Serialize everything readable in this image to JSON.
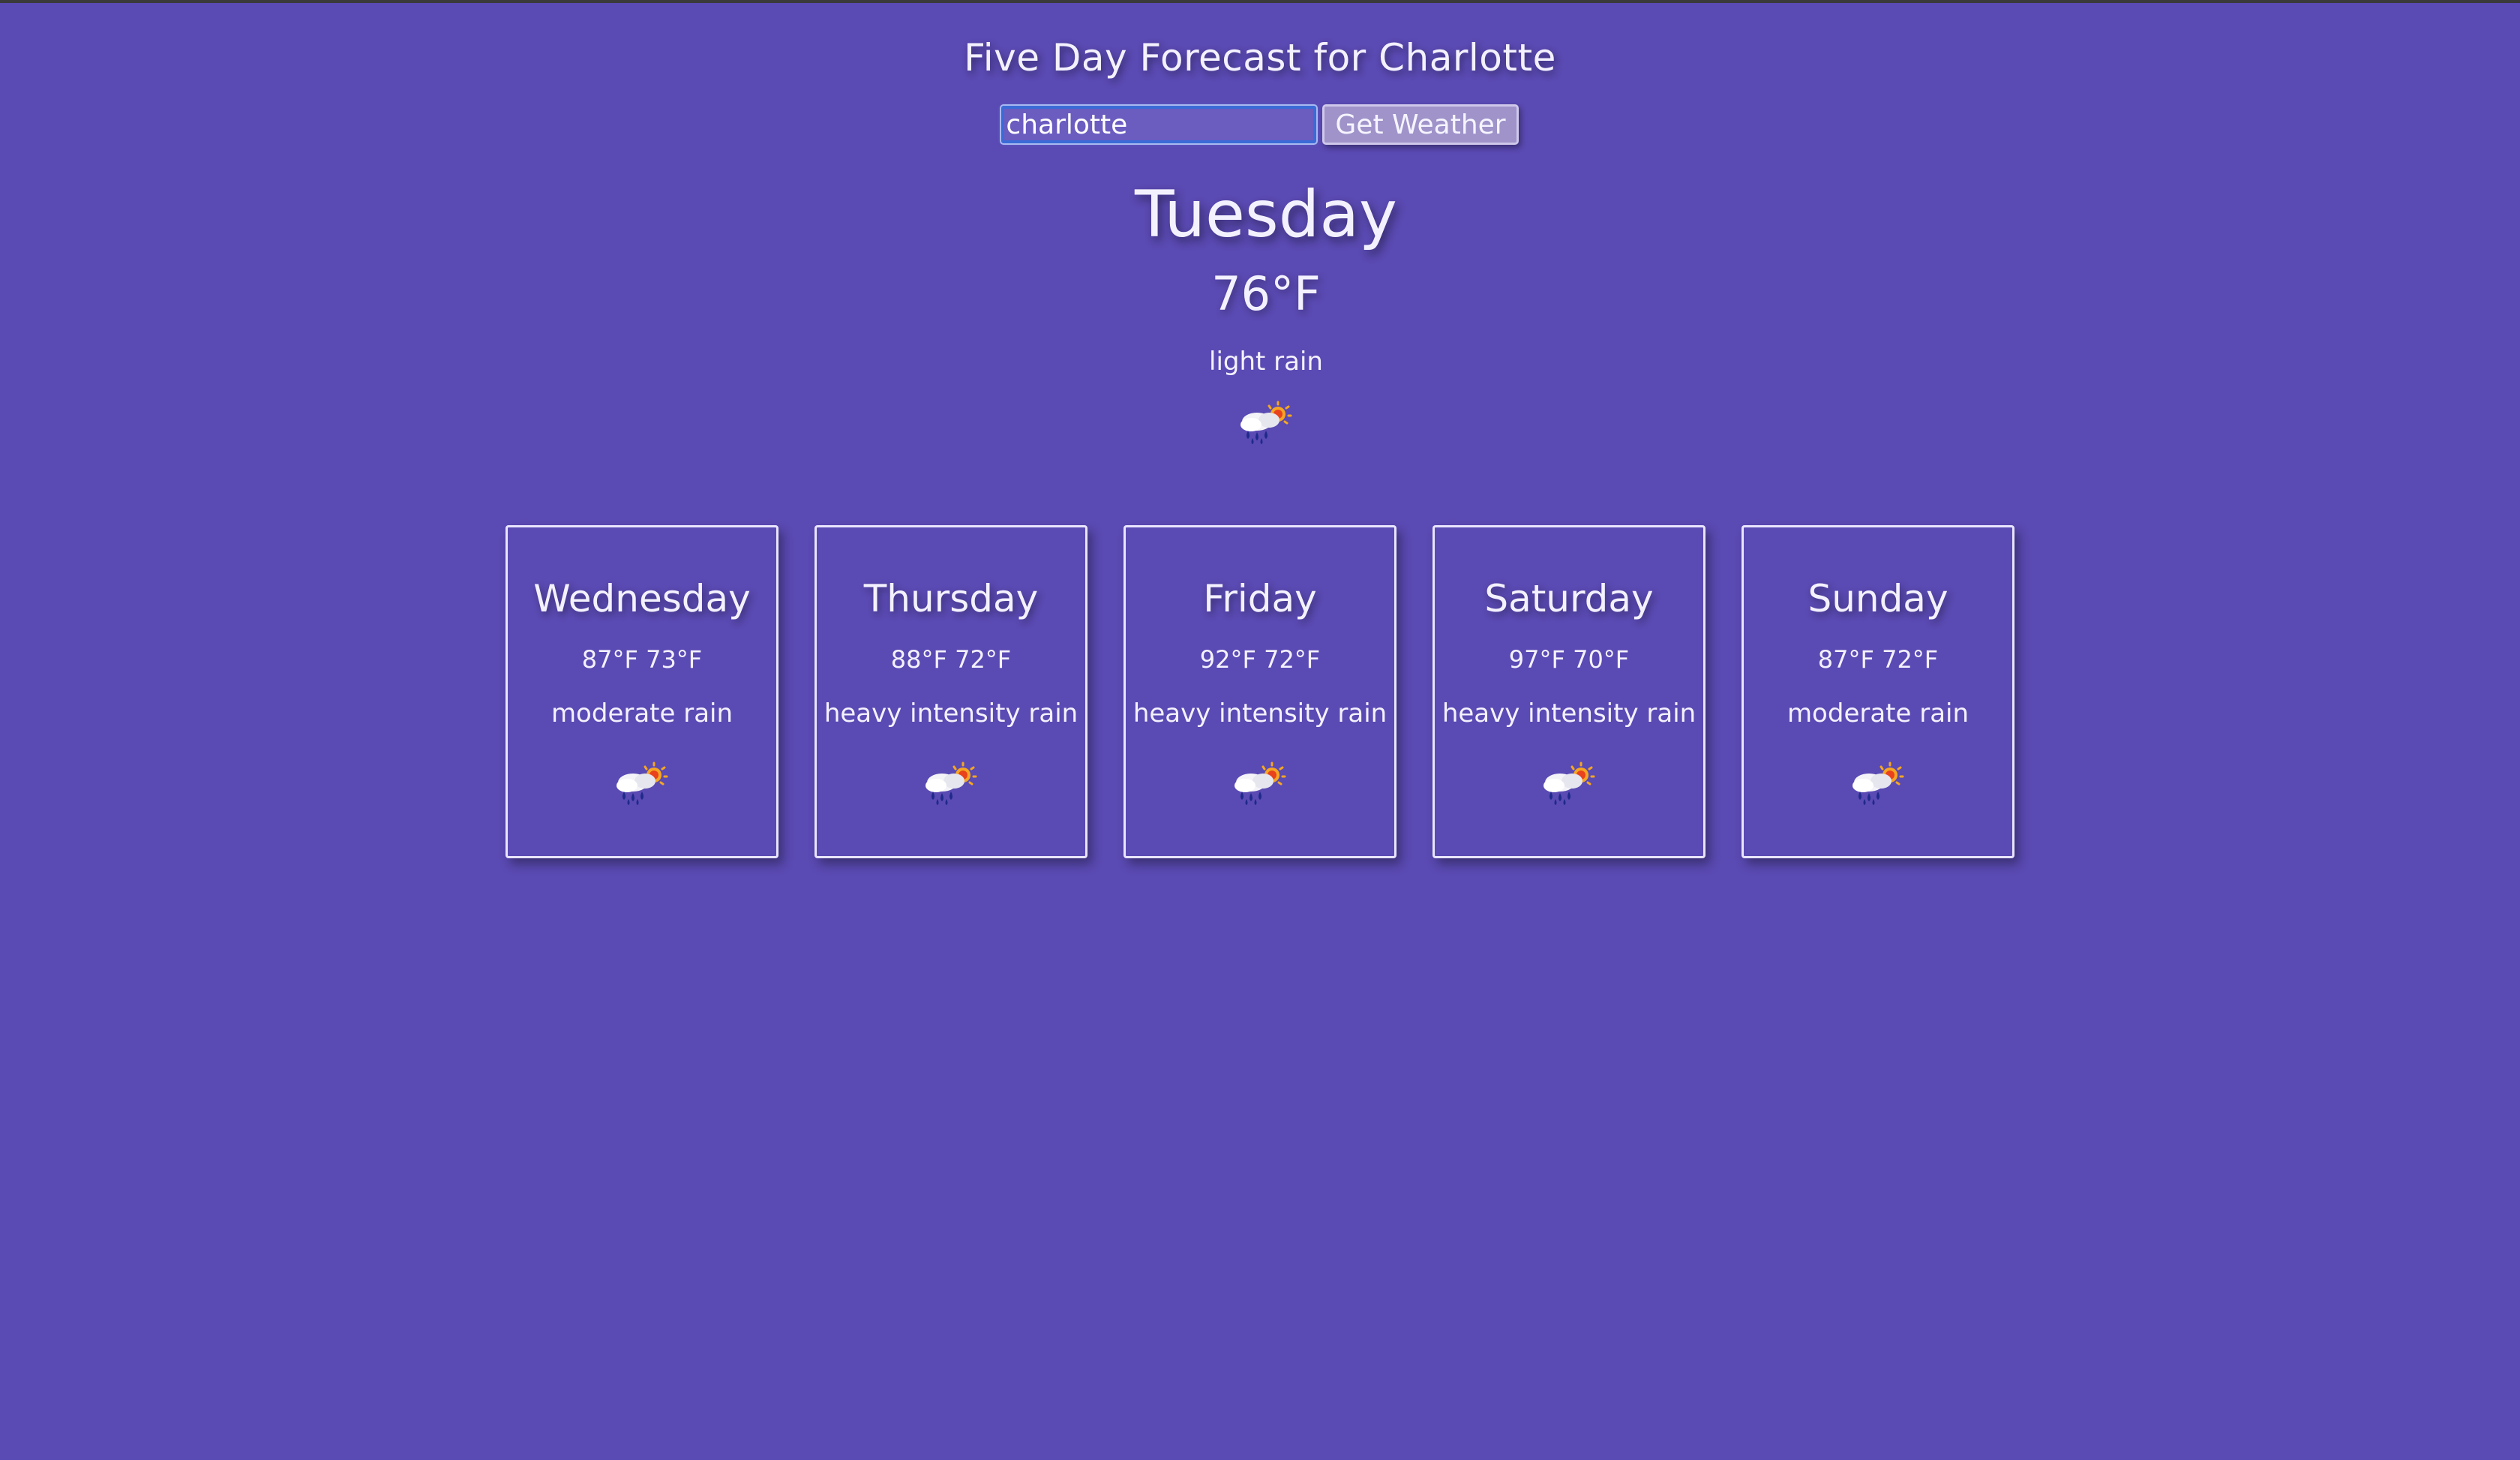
{
  "header": {
    "title": "Five Day Forecast for Charlotte"
  },
  "search": {
    "value": "charlotte",
    "button_label": "Get Weather"
  },
  "today": {
    "day": "Tuesday",
    "temp": "76°F",
    "description": "light rain",
    "icon": "rain-sun-icon"
  },
  "forecast": [
    {
      "day": "Wednesday",
      "temps": "87°F 73°F",
      "description": "moderate rain",
      "icon": "rain-sun-icon"
    },
    {
      "day": "Thursday",
      "temps": "88°F 72°F",
      "description": "heavy intensity rain",
      "icon": "rain-sun-icon"
    },
    {
      "day": "Friday",
      "temps": "92°F 72°F",
      "description": "heavy intensity rain",
      "icon": "rain-sun-icon"
    },
    {
      "day": "Saturday",
      "temps": "97°F 70°F",
      "description": "heavy intensity rain",
      "icon": "rain-sun-icon"
    },
    {
      "day": "Sunday",
      "temps": "87°F 72°F",
      "description": "moderate rain",
      "icon": "rain-sun-icon"
    }
  ],
  "colors": {
    "background": "#5a4ab3",
    "text": "#f4f1ff",
    "card_border": "#e9e5ff",
    "input_focus": "#3b6bd6",
    "button_bg": "#9f93c9"
  }
}
